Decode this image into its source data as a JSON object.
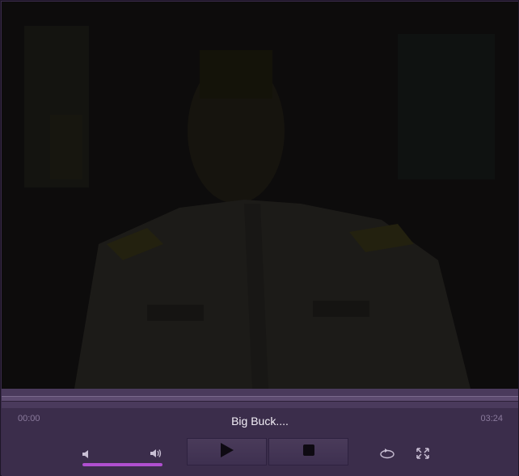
{
  "player": {
    "title": "Big Buck....",
    "time_elapsed": "00:00",
    "time_total": "03:24",
    "volume_level": 1.0,
    "accent_color": "#b04fd0",
    "background_color": "#3b2d4b"
  },
  "icons": {
    "mute": "speaker-mute-icon",
    "volume": "speaker-volume-icon",
    "play": "play-icon",
    "stop": "stop-icon",
    "loop": "loop-icon",
    "fullscreen": "fullscreen-icon"
  }
}
